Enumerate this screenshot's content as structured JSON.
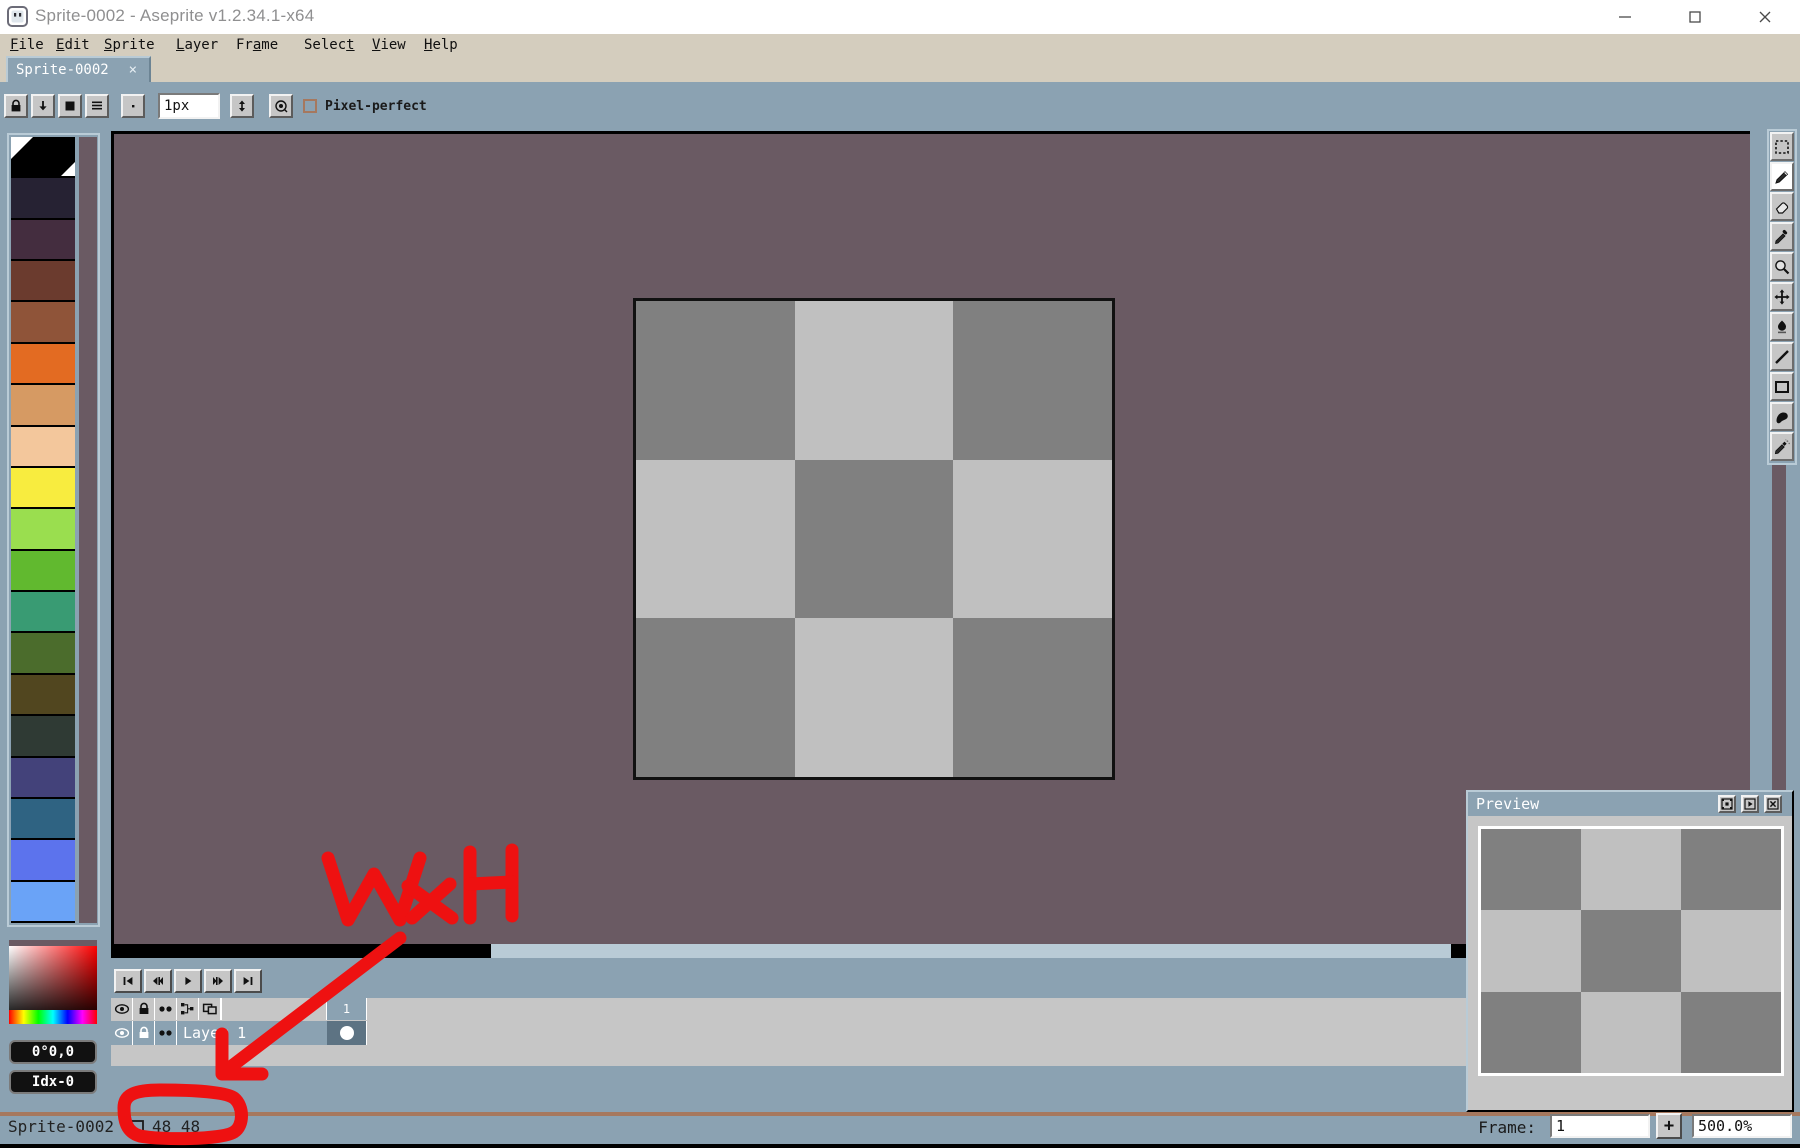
{
  "window": {
    "title": "Sprite-0002 - Aseprite v1.2.34.1-x64",
    "app_icon": "aseprite-icon",
    "minimize": "–",
    "maximize": "□",
    "close": "✕"
  },
  "menubar": {
    "items": [
      {
        "label": "File",
        "accel": "F"
      },
      {
        "label": "Edit",
        "accel": "E"
      },
      {
        "label": "Sprite",
        "accel": "S"
      },
      {
        "label": "Layer",
        "accel": "L"
      },
      {
        "label": "Frame",
        "accel": "a"
      },
      {
        "label": "Select",
        "accel": "t"
      },
      {
        "label": "View",
        "accel": "V"
      },
      {
        "label": "Help",
        "accel": "H"
      }
    ]
  },
  "tabs": [
    {
      "label": "Sprite-0002",
      "close": "×",
      "active": true
    }
  ],
  "context_toolbar": {
    "buttons": [
      {
        "name": "ink-lock-alpha",
        "icon": "lock-icon"
      },
      {
        "name": "ink-alpha-compositing",
        "icon": "down-arrow-icon"
      },
      {
        "name": "ink-opaque",
        "icon": "filled-square-icon"
      },
      {
        "name": "ink-options",
        "icon": "menu-lines-icon"
      },
      {
        "name": "brush-type",
        "icon": "dot-icon"
      }
    ],
    "brush_size_value": "1px",
    "brush_size_placeholder": "1px",
    "symmetry_icon": "symmetry-icon",
    "dynamics_icon": "dynamics-icon",
    "pixel_perfect_label": "Pixel-perfect",
    "pixel_perfect_checked": false
  },
  "palette": {
    "selected_index": 0,
    "colors": [
      "#000000",
      "#252238",
      "#432d40",
      "#5e382f",
      "#8a523a",
      "#e3682a",
      "#d79a62",
      "#f1c49b",
      "#f7e council",
      "#9fdd50"
    ],
    "swatches": [
      "#000000",
      "#262233",
      "#442d3f",
      "#6b3b2e",
      "#8f5439",
      "#e36b22",
      "#d69a63",
      "#f3c79c",
      "#f8ec3f",
      "#9ade4f",
      "#61b92f",
      "#399b73",
      "#4b6c2c",
      "#51461f",
      "#2f3a34",
      "#43427a",
      "#2f6382",
      "#5c73ed",
      "#6aa3f7"
    ],
    "handle_color": "#6a5a63"
  },
  "color_picker": {
    "current_color": "#ff0000",
    "coords_label": "0°0,0",
    "index_label": "Idx-0"
  },
  "canvas": {
    "background": "#6a5a63",
    "sprite": {
      "width": 48,
      "height": 48,
      "grid": [
        [
          "#808080",
          "#c0c0c0",
          "#808080"
        ],
        [
          "#c0c0c0",
          "#808080",
          "#c0c0c0"
        ],
        [
          "#808080",
          "#c0c0c0",
          "#808080"
        ]
      ],
      "border_color": "#111111"
    }
  },
  "tools": [
    {
      "name": "rectangular-marquee-tool",
      "icon": "marquee-icon",
      "active": false
    },
    {
      "name": "pencil-tool",
      "icon": "pencil-icon",
      "active": true
    },
    {
      "name": "eraser-tool",
      "icon": "eraser-icon",
      "active": false
    },
    {
      "name": "eyedropper-tool",
      "icon": "eyedropper-icon",
      "active": false
    },
    {
      "name": "zoom-tool",
      "icon": "magnifier-icon",
      "active": false
    },
    {
      "name": "move-tool",
      "icon": "move-arrows-icon",
      "active": false
    },
    {
      "name": "paint-bucket-tool",
      "icon": "paint-bucket-icon",
      "active": false
    },
    {
      "name": "line-tool",
      "icon": "line-icon",
      "active": false
    },
    {
      "name": "rectangle-tool",
      "icon": "rectangle-icon",
      "active": false
    },
    {
      "name": "contour-tool",
      "icon": "blob-icon",
      "active": false
    },
    {
      "name": "spray-tool",
      "icon": "spray-icon",
      "active": false
    }
  ],
  "frame_nav": {
    "buttons": [
      {
        "name": "go-first-frame",
        "glyph": "first"
      },
      {
        "name": "go-previous-frame",
        "glyph": "prev"
      },
      {
        "name": "play-animation",
        "glyph": "play"
      },
      {
        "name": "go-next-frame",
        "glyph": "next"
      },
      {
        "name": "go-last-frame",
        "glyph": "last"
      }
    ]
  },
  "timeline": {
    "header_icons": [
      "eye-icon",
      "lock-icon",
      "continuous-icon",
      "group-icon",
      "new-layer-icon"
    ],
    "frame_column_header": "1",
    "layers": [
      {
        "name": "Layer 1",
        "visible": true,
        "locked": true,
        "continuous": true,
        "has_cel": true
      }
    ]
  },
  "preview": {
    "title": "Preview",
    "buttons": [
      {
        "name": "preview-fit-button",
        "icon": "fit-icon"
      },
      {
        "name": "preview-play-button",
        "icon": "play-icon"
      },
      {
        "name": "preview-close-button",
        "icon": "close-icon"
      }
    ],
    "grid": [
      [
        "#808080",
        "#c0c0c0",
        "#808080"
      ],
      [
        "#c0c0c0",
        "#808080",
        "#c0c0c0"
      ],
      [
        "#808080",
        "#c0c0c0",
        "#808080"
      ]
    ]
  },
  "statusbar": {
    "sprite_name": "Sprite-0002",
    "size_icon": "canvas-size-icon",
    "size_text": "48  48",
    "frame_label": "Frame:",
    "frame_value": "1",
    "frame_placeholder": "1",
    "add_frame_label": "+",
    "zoom_value": "500.0%",
    "zoom_placeholder": "500.0%"
  },
  "annotations": {
    "text": "W×H",
    "color": "#ee1111",
    "note": "handwritten red W×H label with arrow pointing at the 48 48 size readout, which is circled"
  }
}
